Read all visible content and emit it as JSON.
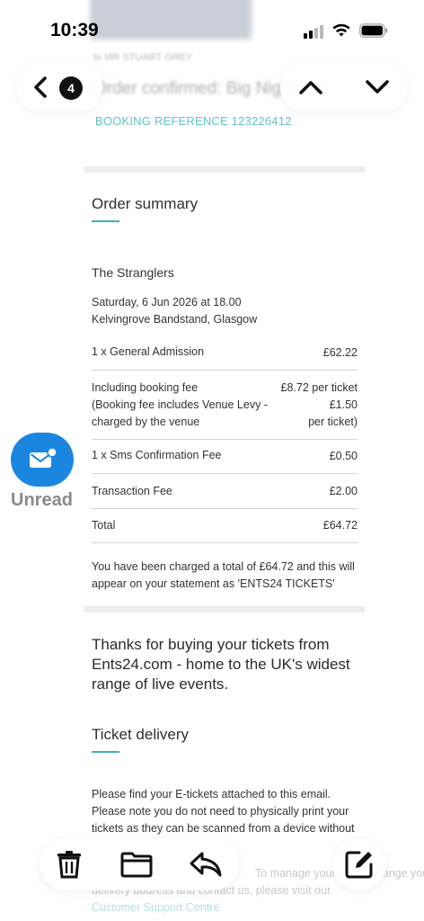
{
  "status_bar": {
    "time": "10:39"
  },
  "nav": {
    "unread_count": "4"
  },
  "background": {
    "sender": "to MR STUART GREY",
    "subject": "Order confirmed: Big Night Out"
  },
  "email": {
    "booking_reference": "BOOKING REFERENCE 123226412",
    "order_summary_title": "Order summary",
    "event": {
      "name": "The Stranglers",
      "date": "Saturday, 6 Jun 2026 at 18.00",
      "venue": "Kelvingrove Bandstand, Glasgow"
    },
    "line_items": {
      "ticket_label": "1 x General Admission",
      "ticket_price": "£62.22",
      "fee_label_1": "Including booking fee",
      "fee_label_2": "(Booking fee includes Venue Levy -",
      "fee_label_3": "charged by the venue",
      "fee_value_1": "£8.72 per ticket",
      "fee_value_2": "£1.50",
      "fee_value_3": "per ticket)",
      "sms_label": "1 x Sms Confirmation Fee",
      "sms_price": "£0.50",
      "transaction_label": "Transaction Fee",
      "transaction_price": "£2.00",
      "total_label": "Total",
      "total_price": "£64.72"
    },
    "charge_note_1": "You have been charged a total of £64.72 and this will",
    "charge_note_2": "appear on your statement as 'ENTS24 TICKETS'",
    "thanks_text": "Thanks for buying your tickets from Ents24.com - home to the UK's widest range of live events.",
    "delivery_title": "Ticket delivery",
    "delivery_text": "Please find your E-tickets attached to this email. Please note you do not need to physically print your tickets as they can be scanned from a device without",
    "faded_text_1": "To manage your order, change your",
    "faded_text_2": "delivery address and contact us, please visit our",
    "support_link": "Customer Support Centre"
  },
  "side_action": {
    "label": "Unread",
    "color": "#1a86e0"
  },
  "colors": {
    "accent_teal": "#3fb1b5"
  }
}
